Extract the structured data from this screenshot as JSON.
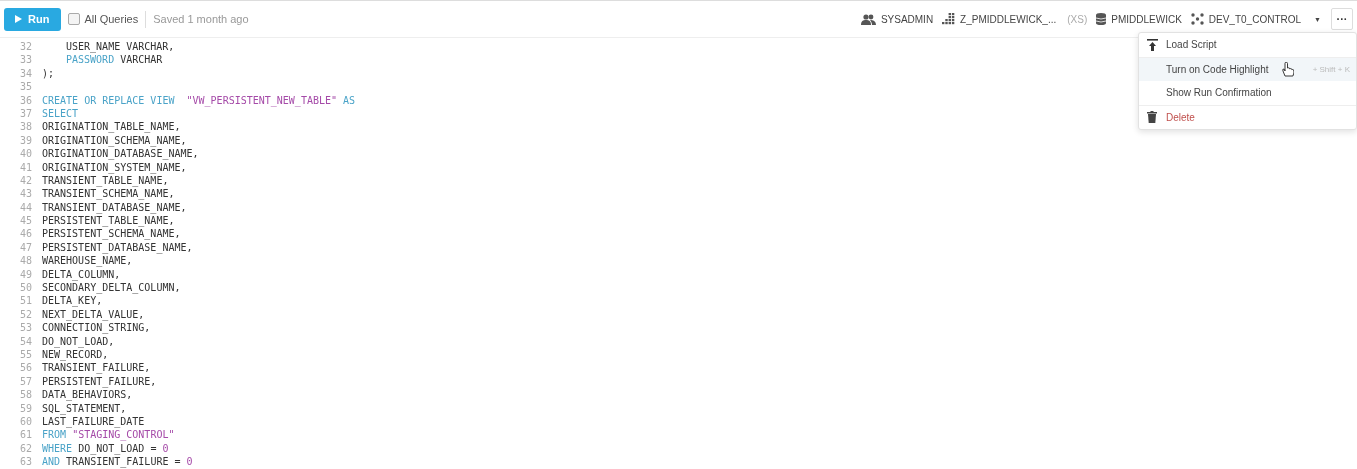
{
  "toolbar": {
    "run_label": "Run",
    "all_queries": {
      "label": "All Queries",
      "checked": false
    },
    "saved": "Saved 1 month ago",
    "context": [
      {
        "kind": "role",
        "label": "SYSADMIN"
      },
      {
        "kind": "warehouse",
        "label": "Z_PMIDDLEWICK_...",
        "size": "(XS)"
      },
      {
        "kind": "database",
        "label": "PMIDDLEWICK"
      },
      {
        "kind": "schema",
        "label": "DEV_T0_CONTROL",
        "caret": "▼"
      }
    ],
    "more": "···"
  },
  "menu": {
    "items": [
      {
        "kind": "load",
        "label": "Load Script",
        "selected": false
      },
      {
        "kind": "plain",
        "label": "Turn on Code Highlight",
        "shortcut": "+ Shift + K",
        "selected": true
      },
      {
        "kind": "plain",
        "label": "Show Run Confirmation",
        "selected": false
      },
      {
        "kind": "delete",
        "label": "Delete",
        "selected": false
      }
    ]
  },
  "editor": {
    "lines": [
      {
        "number": "32",
        "indented": true,
        "tokens": [
          {
            "kind": "plain",
            "text": "USER_NAME VARCHAR,"
          }
        ]
      },
      {
        "number": "33",
        "indented": true,
        "tokens": [
          {
            "kind": "keyword",
            "text": "PASSWORD"
          },
          {
            "kind": "plain",
            "text": "VARCHAR"
          }
        ]
      },
      {
        "number": "34",
        "tokens": [
          {
            "kind": "plain",
            "text": ");"
          }
        ]
      },
      {
        "number": "35"
      },
      {
        "number": "36",
        "tokens": [
          {
            "kind": "keyword",
            "text": "CREATE OR REPLACE VIEW"
          },
          {
            "kind": "string",
            "text": " \"VW_PERSISTENT_NEW_TABLE\""
          },
          {
            "kind": "keyword",
            "text": "AS"
          }
        ]
      },
      {
        "number": "37",
        "tokens": [
          {
            "kind": "keyword",
            "text": "SELECT"
          }
        ]
      },
      {
        "number": "38",
        "tokens": [
          {
            "kind": "plain",
            "text": "ORIGINATION_TABLE_NAME,"
          }
        ]
      },
      {
        "number": "39",
        "tokens": [
          {
            "kind": "plain",
            "text": "ORIGINATION_SCHEMA_NAME,"
          }
        ]
      },
      {
        "number": "40",
        "tokens": [
          {
            "kind": "plain",
            "text": "ORIGINATION_DATABASE_NAME,"
          }
        ]
      },
      {
        "number": "41",
        "tokens": [
          {
            "kind": "plain",
            "text": "ORIGINATION_SYSTEM_NAME,"
          }
        ]
      },
      {
        "number": "42",
        "tokens": [
          {
            "kind": "plain",
            "text": "TRANSIENT_TABLE_NAME,"
          }
        ]
      },
      {
        "number": "43",
        "tokens": [
          {
            "kind": "plain",
            "text": "TRANSIENT_SCHEMA_NAME,"
          }
        ]
      },
      {
        "number": "44",
        "tokens": [
          {
            "kind": "plain",
            "text": "TRANSIENT_DATABASE_NAME,"
          }
        ]
      },
      {
        "number": "45",
        "tokens": [
          {
            "kind": "plain",
            "text": "PERSISTENT_TABLE_NAME,"
          }
        ]
      },
      {
        "number": "46",
        "tokens": [
          {
            "kind": "plain",
            "text": "PERSISTENT_SCHEMA_NAME,"
          }
        ]
      },
      {
        "number": "47",
        "tokens": [
          {
            "kind": "plain",
            "text": "PERSISTENT_DATABASE_NAME,"
          }
        ]
      },
      {
        "number": "48",
        "tokens": [
          {
            "kind": "plain",
            "text": "WAREHOUSE_NAME,"
          }
        ]
      },
      {
        "number": "49",
        "tokens": [
          {
            "kind": "plain",
            "text": "DELTA_COLUMN,"
          }
        ]
      },
      {
        "number": "50",
        "tokens": [
          {
            "kind": "plain",
            "text": "SECONDARY_DELTA_COLUMN,"
          }
        ]
      },
      {
        "number": "51",
        "tokens": [
          {
            "kind": "plain",
            "text": "DELTA_KEY,"
          }
        ]
      },
      {
        "number": "52",
        "tokens": [
          {
            "kind": "plain",
            "text": "NEXT_DELTA_VALUE,"
          }
        ]
      },
      {
        "number": "53",
        "tokens": [
          {
            "kind": "plain",
            "text": "CONNECTION_STRING,"
          }
        ]
      },
      {
        "number": "54",
        "tokens": [
          {
            "kind": "plain",
            "text": "DO_NOT_LOAD,"
          }
        ]
      },
      {
        "number": "55",
        "tokens": [
          {
            "kind": "plain",
            "text": "NEW_RECORD,"
          }
        ]
      },
      {
        "number": "56",
        "tokens": [
          {
            "kind": "plain",
            "text": "TRANSIENT_FAILURE,"
          }
        ]
      },
      {
        "number": "57",
        "tokens": [
          {
            "kind": "plain",
            "text": "PERSISTENT_FAILURE,"
          }
        ]
      },
      {
        "number": "58",
        "tokens": [
          {
            "kind": "plain",
            "text": "DATA_BEHAVIORS,"
          }
        ]
      },
      {
        "number": "59",
        "tokens": [
          {
            "kind": "plain",
            "text": "SQL_STATEMENT,"
          }
        ]
      },
      {
        "number": "60",
        "tokens": [
          {
            "kind": "plain",
            "text": "LAST_FAILURE_DATE"
          }
        ]
      },
      {
        "number": "61",
        "tokens": [
          {
            "kind": "keyword",
            "text": "FROM"
          },
          {
            "kind": "string",
            "text": "\"STAGING_CONTROL\""
          }
        ]
      },
      {
        "number": "62",
        "tokens": [
          {
            "kind": "keyword",
            "text": "WHERE"
          },
          {
            "kind": "plain",
            "text": "DO_NOT_LOAD ="
          },
          {
            "kind": "number",
            "text": "0"
          }
        ]
      },
      {
        "number": "63",
        "tokens": [
          {
            "kind": "keyword",
            "text": "AND"
          },
          {
            "kind": "plain",
            "text": "TRANSIENT_FAILURE ="
          },
          {
            "kind": "number",
            "text": "0"
          }
        ]
      }
    ]
  }
}
